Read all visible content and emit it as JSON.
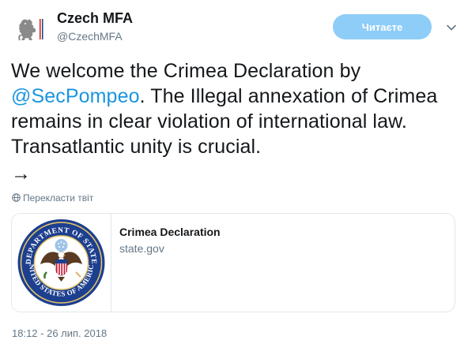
{
  "account": {
    "display_name": "Czech MFA",
    "handle": "@CzechMFA",
    "avatar_icon": "czech-coat-of-arms-icon"
  },
  "follow_button": {
    "label": "Читаєте",
    "color": "#8ecdf8"
  },
  "tweet": {
    "text_before": "We welcome the Crimea Declaration by ",
    "mention": "@SecPompeo",
    "text_after": ". The Illegal annexation of Crimea remains in clear violation of international law. Transatlantic unity is crucial.",
    "arrow": "→"
  },
  "translate": {
    "label": "Перекласти твіт",
    "icon": "globe-icon"
  },
  "card": {
    "title": "Crimea Declaration",
    "domain": "state.gov",
    "image_icon": "department-of-state-seal-icon",
    "seal_top_text": "DEPARTMENT OF STATE",
    "seal_bottom_text": "UNITED STATES OF AMERICA"
  },
  "timestamp": "18:12 - 26 лип. 2018",
  "colors": {
    "link": "#1b95e0",
    "secondary": "#657786",
    "border": "#e1e8ed"
  }
}
